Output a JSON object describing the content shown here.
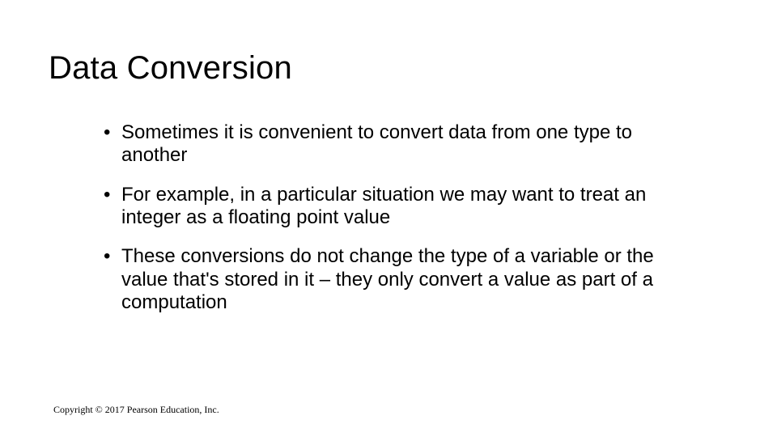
{
  "title": "Data Conversion",
  "bullets": [
    "Sometimes it is convenient to convert data from one type to another",
    "For example, in a particular situation we may want to treat an integer as a floating point value",
    "These conversions do not change the type of a variable or the value that's stored in it – they only convert a value as part of a computation"
  ],
  "footer": "Copyright © 2017 Pearson Education, Inc."
}
